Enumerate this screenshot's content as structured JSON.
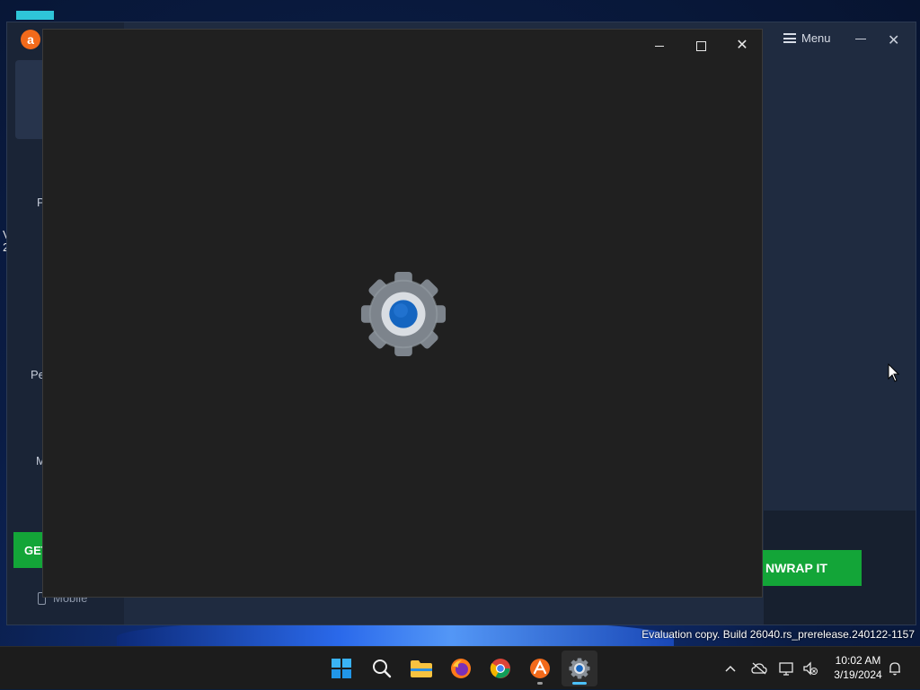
{
  "background_app": {
    "logo_glyph": "a",
    "sidebar_fragments": [
      "P",
      "Pe",
      "M"
    ],
    "get_button_fragment": "GET",
    "mobile_label": "Mobile",
    "menu_label": "Menu",
    "close_glyph": "✕",
    "cta_button_fragment": "NWRAP IT",
    "accent_green": "#13a538",
    "brand_orange": "#f26a1b"
  },
  "desktop": {
    "edge_fragments": [
      "V",
      "2"
    ]
  },
  "settings_window": {
    "close_glyph": "✕",
    "splash_icon": "settings-gear-icon",
    "background": "#202020"
  },
  "watermark": {
    "text": "Evaluation copy. Build 26040.rs_prerelease.240122-1157"
  },
  "taskbar": {
    "apps": [
      {
        "name": "start",
        "icon": "windows-logo-icon"
      },
      {
        "name": "search",
        "icon": "search-icon"
      },
      {
        "name": "file-explorer",
        "icon": "folder-icon"
      },
      {
        "name": "firefox",
        "icon": "firefox-icon"
      },
      {
        "name": "chrome",
        "icon": "chrome-icon"
      },
      {
        "name": "avast",
        "icon": "avast-icon",
        "running": true
      },
      {
        "name": "settings",
        "icon": "settings-gear-icon",
        "running": true,
        "active": true
      }
    ],
    "clock": {
      "time": "10:02 AM",
      "date": "3/19/2024"
    }
  }
}
